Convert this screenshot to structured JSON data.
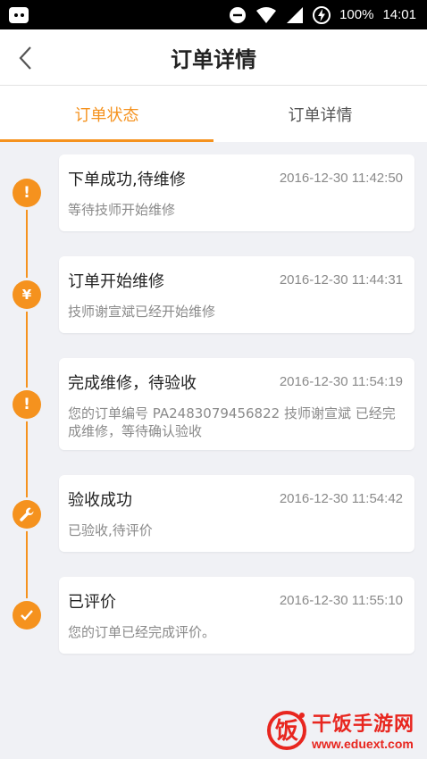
{
  "status_bar": {
    "battery": "100%",
    "time": "14:01",
    "icons": [
      "app-badge-icon",
      "minus-circle-icon",
      "wifi-icon",
      "signal-icon",
      "charging-icon"
    ]
  },
  "header": {
    "title": "订单详情",
    "back_icon": "chevron-left-icon"
  },
  "tabs": [
    {
      "label": "订单状态",
      "active": true
    },
    {
      "label": "订单详情",
      "active": false
    }
  ],
  "accent_color": "#f5921e",
  "timeline": [
    {
      "icon": "exclamation-icon",
      "title": "下单成功,待维修",
      "time": "2016-12-30 11:42:50",
      "desc": "等待技师开始维修"
    },
    {
      "icon": "yen-icon",
      "title": "订单开始维修",
      "time": "2016-12-30 11:44:31",
      "desc": "技师谢宣斌已经开始维修"
    },
    {
      "icon": "exclamation-icon",
      "title": "完成维修，待验收",
      "time": "2016-12-30 11:54:19",
      "desc": "您的订单编号 PA2483079456822 技师谢宣斌 已经完成维修，等待确认验收"
    },
    {
      "icon": "wrench-icon",
      "title": "验收成功",
      "time": "2016-12-30 11:54:42",
      "desc": "已验收,待评价"
    },
    {
      "icon": "checkmark-icon",
      "title": "已评价",
      "time": "2016-12-30 11:55:10",
      "desc": "您的订单已经完成评价。"
    }
  ],
  "watermark": {
    "logo_char": "饭",
    "name": "干饭手游网",
    "url": "www.eduext.com"
  }
}
